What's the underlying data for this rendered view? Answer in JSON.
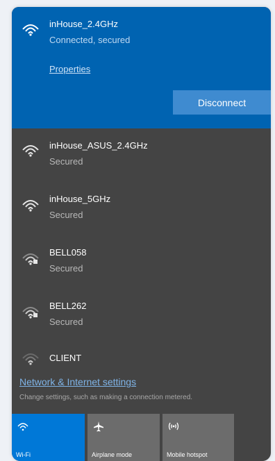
{
  "connected_network": {
    "name": "inHouse_2.4GHz",
    "status": "Connected, secured",
    "properties_label": "Properties",
    "disconnect_label": "Disconnect",
    "icon": "wifi-signal-icon"
  },
  "networks": [
    {
      "name": "inHouse_ASUS_2.4GHz",
      "status": "Secured",
      "icon": "wifi-signal-icon"
    },
    {
      "name": "inHouse_5GHz",
      "status": "Secured",
      "icon": "wifi-signal-icon"
    },
    {
      "name": "BELL058",
      "status": "Secured",
      "icon": "wifi-secured-icon"
    },
    {
      "name": "BELL262",
      "status": "Secured",
      "icon": "wifi-secured-icon"
    },
    {
      "name": "CLIENT",
      "status": "",
      "icon": "wifi-weak-icon"
    }
  ],
  "settings": {
    "link_label": "Network & Internet settings",
    "description": "Change settings, such as making a connection metered."
  },
  "quick_actions": [
    {
      "label": "Wi-Fi",
      "icon": "wifi-icon",
      "active": true
    },
    {
      "label": "Airplane mode",
      "icon": "airplane-icon",
      "active": false
    },
    {
      "label": "Mobile hotspot",
      "icon": "hotspot-icon",
      "active": false
    }
  ],
  "colors": {
    "accent": "#0063b1",
    "panel_bg": "#444444",
    "tile_active": "#0078d7",
    "tile_inactive": "#6c6c6c"
  }
}
